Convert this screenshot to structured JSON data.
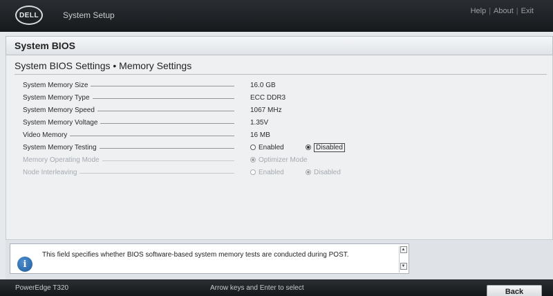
{
  "header": {
    "logo_text": "DELL",
    "app_title": "System Setup",
    "links": [
      "Help",
      "About",
      "Exit"
    ]
  },
  "section": {
    "title": "System BIOS"
  },
  "page": {
    "title": "System BIOS Settings • Memory Settings"
  },
  "settings": [
    {
      "label": "System Memory Size",
      "value": "16.0 GB"
    },
    {
      "label": "System Memory Type",
      "value": "ECC DDR3"
    },
    {
      "label": "System Memory Speed",
      "value": "1067 MHz"
    },
    {
      "label": "System Memory Voltage",
      "value": "1.35V"
    },
    {
      "label": "Video Memory",
      "value": "16 MB"
    }
  ],
  "memory_testing": {
    "label": "System Memory Testing",
    "options": [
      "Enabled",
      "Disabled"
    ],
    "selected": "Disabled"
  },
  "operating_mode": {
    "label": "Memory Operating Mode",
    "value": "Optimizer Mode"
  },
  "node_interleaving": {
    "label": "Node Interleaving",
    "options": [
      "Enabled",
      "Disabled"
    ],
    "selected": "Disabled"
  },
  "help": {
    "text": "This field specifies whether BIOS software-based system memory tests are conducted during POST."
  },
  "footer": {
    "model": "PowerEdge T320",
    "hint": "Arrow keys and Enter to select",
    "back_label": "Back"
  }
}
